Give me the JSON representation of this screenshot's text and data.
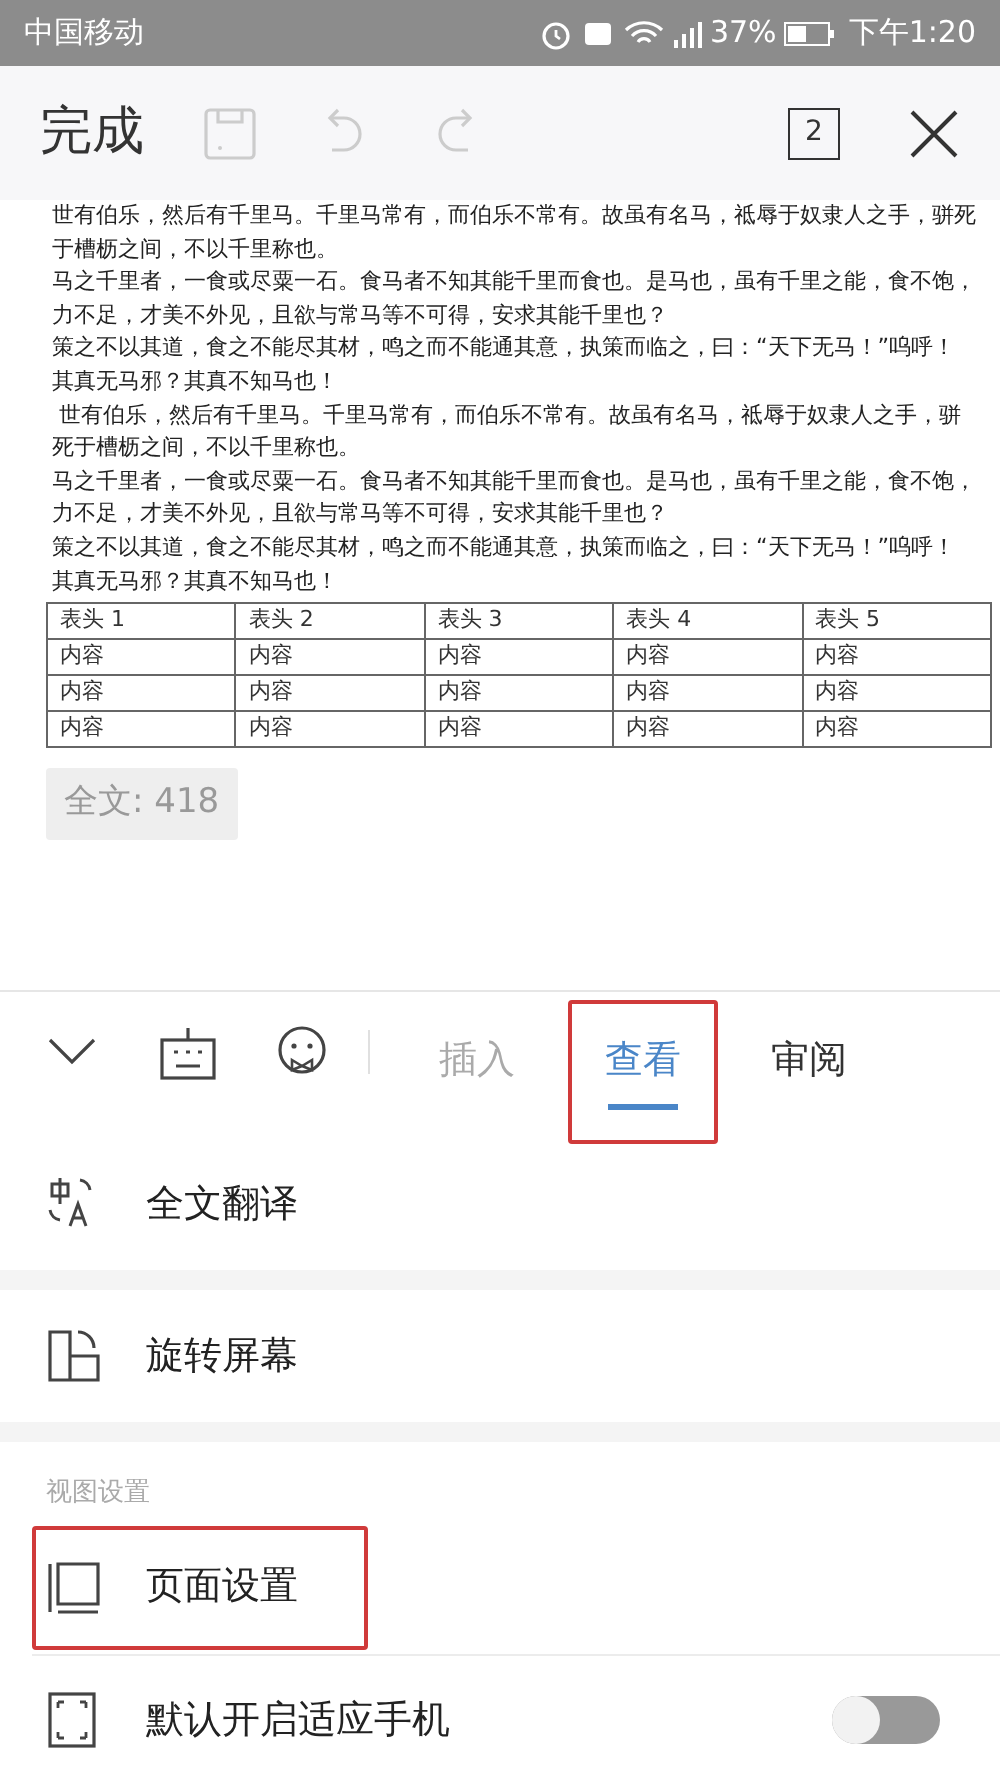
{
  "status_bar": {
    "carrier": "中国移动",
    "battery": "37%",
    "time": "下午1:20"
  },
  "toolbar": {
    "done": "完成",
    "page_count": "2"
  },
  "document": {
    "paragraphs": [
      "世有伯乐，然后有千里马。千里马常有，而伯乐不常有。故虽有名马，祗辱于奴隶人之手，骈死于槽枥之间，不以千里称也。",
      "马之千里者，一食或尽粟一石。食马者不知其能千里而食也。是马也，虽有千里之能，食不饱，力不足，才美不外见，且欲与常马等不可得，安求其能千里也？",
      "策之不以其道，食之不能尽其材，鸣之而不能通其意，执策而临之，曰：“天下无马！”呜呼！其真无马邪？其真不知马也！",
      " 世有伯乐，然后有千里马。千里马常有，而伯乐不常有。故虽有名马，祗辱于奴隶人之手，骈死于槽枥之间，不以千里称也。",
      "马之千里者，一食或尽粟一石。食马者不知其能千里而食也。是马也，虽有千里之能，食不饱，力不足，才美不外见，且欲与常马等不可得，安求其能千里也？",
      "策之不以其道，食之不能尽其材，鸣之而不能通其意，执策而临之，曰：“天下无马！”呜呼！其真无马邪？其真不知马也！"
    ],
    "table": {
      "columns": [
        "表头 1",
        "表头 2",
        "表头 3",
        "表头 4",
        "表头 5"
      ],
      "rows": [
        [
          "内容",
          "内容",
          "内容",
          "内容",
          "内容"
        ],
        [
          "内容",
          "内容",
          "内容",
          "内容",
          "内容"
        ],
        [
          "内容",
          "内容",
          "内容",
          "内容",
          "内容"
        ]
      ]
    },
    "word_count": "全文: 418"
  },
  "tabs": [
    {
      "label": "插入",
      "selected": false,
      "highlighted": false
    },
    {
      "label": "查看",
      "selected": true,
      "highlighted": true
    },
    {
      "label": "审阅",
      "selected": false,
      "highlighted": false
    }
  ],
  "menu": [
    {
      "kind": "item",
      "label": "全文翻译",
      "highlighted": false
    },
    {
      "kind": "item",
      "label": "旋转屏幕",
      "highlighted": false
    },
    {
      "kind": "section",
      "label": "视图设置"
    },
    {
      "kind": "item",
      "label": "页面设置",
      "highlighted": true
    },
    {
      "kind": "toggle",
      "label": "默认开启适应手机",
      "on": false
    }
  ]
}
